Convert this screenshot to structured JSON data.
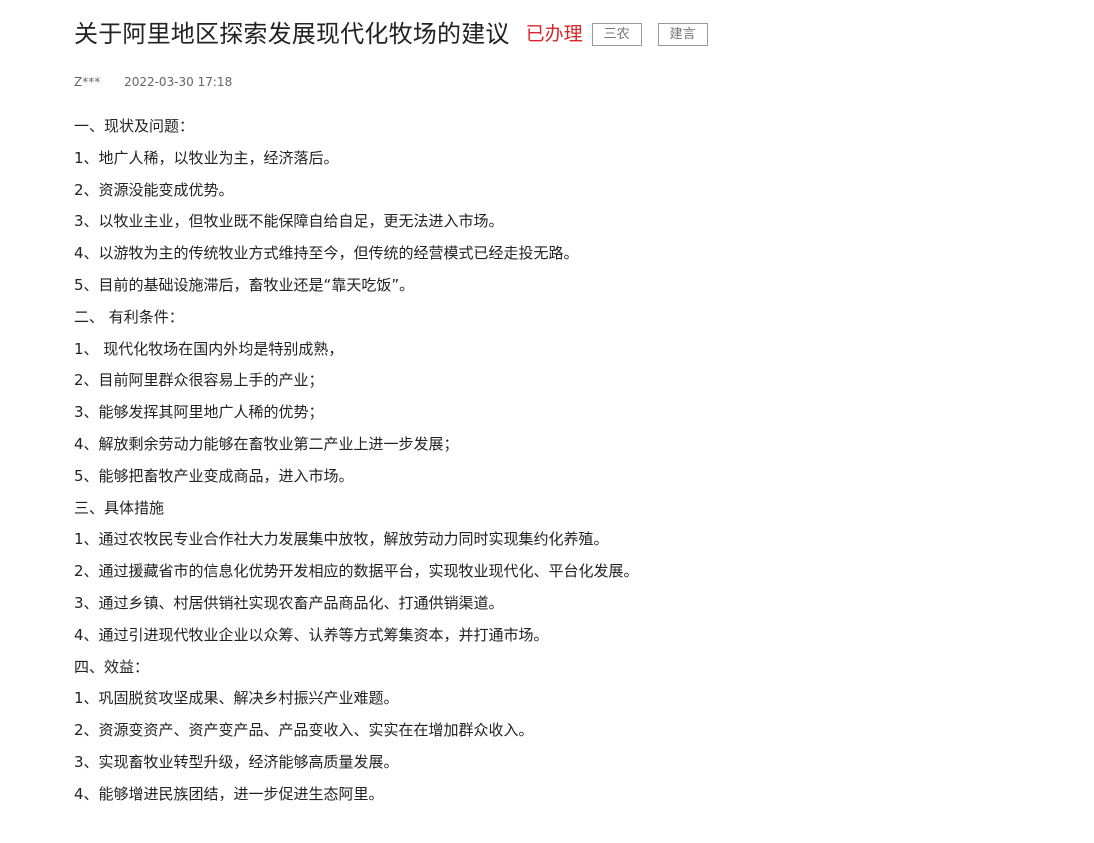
{
  "header": {
    "title": "关于阿里地区探索发展现代化牧场的建议",
    "status": "已办理",
    "tags": [
      "三农",
      "建言"
    ]
  },
  "meta": {
    "author": "Z***",
    "date": "2022-03-30 17:18"
  },
  "body": {
    "lines": [
      "一、现状及问题：",
      "1、地广人稀，以牧业为主，经济落后。",
      "2、资源没能变成优势。",
      "3、以牧业主业，但牧业既不能保障自给自足，更无法进入市场。",
      "4、以游牧为主的传统牧业方式维持至今，但传统的经营模式已经走投无路。",
      "5、目前的基础设施滞后，畜牧业还是“靠天吃饭”。",
      "二、 有利条件：",
      "1、 现代化牧场在国内外均是特别成熟，",
      "2、目前阿里群众很容易上手的产业；",
      "3、能够发挥其阿里地广人稀的优势；",
      "4、解放剩余劳动力能够在畜牧业第二产业上进一步发展；",
      "5、能够把畜牧产业变成商品，进入市场。",
      "三、具体措施",
      "1、通过农牧民专业合作社大力发展集中放牧，解放劳动力同时实现集约化养殖。",
      "2、通过援藏省市的信息化优势开发相应的数据平台，实现牧业现代化、平台化发展。",
      "3、通过乡镇、村居供销社实现农畜产品商品化、打通供销渠道。",
      "4、通过引进现代牧业企业以众筹、认养等方式筹集资本，并打通市场。",
      "四、效益：",
      "1、巩固脱贫攻坚成果、解决乡村振兴产业难题。",
      "2、资源变资产、资产变产品、产品变收入、实实在在增加群众收入。",
      "3、实现畜牧业转型升级，经济能够高质量发展。",
      "4、能够增进民族团结，进一步促进生态阿里。"
    ]
  },
  "colors": {
    "status_red": "#d9252c",
    "tag_border": "#999999",
    "text": "#222222",
    "meta_text": "#666666"
  }
}
